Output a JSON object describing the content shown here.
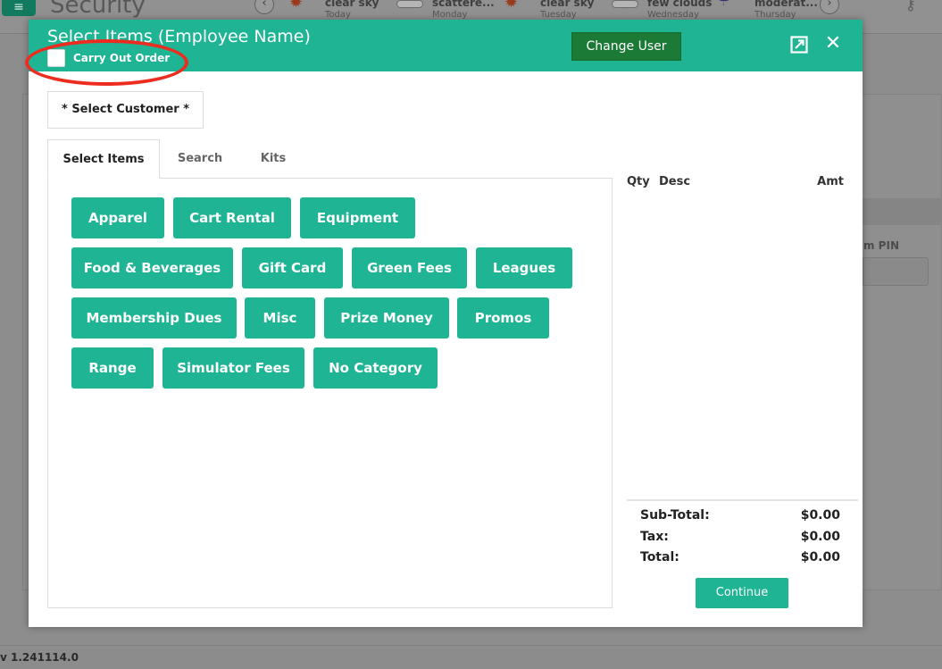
{
  "background": {
    "page_title": "Security",
    "menu_icon": "hamburger-icon",
    "weather": [
      {
        "desc": "clear sky",
        "day": "Today",
        "icon": "sun-icon"
      },
      {
        "desc": "scattere...",
        "day": "Monday",
        "icon": "cloud-icon"
      },
      {
        "desc": "clear sky",
        "day": "Tuesday",
        "icon": "sun-icon"
      },
      {
        "desc": "few clouds",
        "day": "Wednesday",
        "icon": "cloud-icon"
      },
      {
        "desc": "moderat...",
        "day": "Thursday",
        "icon": "rain-icon"
      }
    ],
    "pin_label": "m PIN",
    "version": "v 1.241114.0"
  },
  "modal": {
    "title": "Select Items (Employee Name)",
    "carry_out_label": "Carry Out Order",
    "carry_out_checked": false,
    "change_user_label": "Change User",
    "select_customer_label": "* Select Customer *",
    "tabs": [
      {
        "label": "Select Items",
        "active": true
      },
      {
        "label": "Search",
        "active": false
      },
      {
        "label": "Kits",
        "active": false
      }
    ],
    "categories": [
      "Apparel",
      "Cart Rental",
      "Equipment",
      "Food & Beverages",
      "Gift Card",
      "Green Fees",
      "Leagues",
      "Membership Dues",
      "Misc",
      "Prize Money",
      "Promos",
      "Range",
      "Simulator Fees",
      "No Category"
    ],
    "cart": {
      "columns": {
        "qty": "Qty",
        "desc": "Desc",
        "amt": "Amt"
      },
      "subtotal_label": "Sub-Total:",
      "subtotal_value": "$0.00",
      "tax_label": "Tax:",
      "tax_value": "$0.00",
      "total_label": "Total:",
      "total_value": "$0.00",
      "continue_label": "Continue"
    }
  },
  "colors": {
    "accent": "#1eb494",
    "change_user": "#1a7a36",
    "annotation": "#ee2b1f"
  }
}
